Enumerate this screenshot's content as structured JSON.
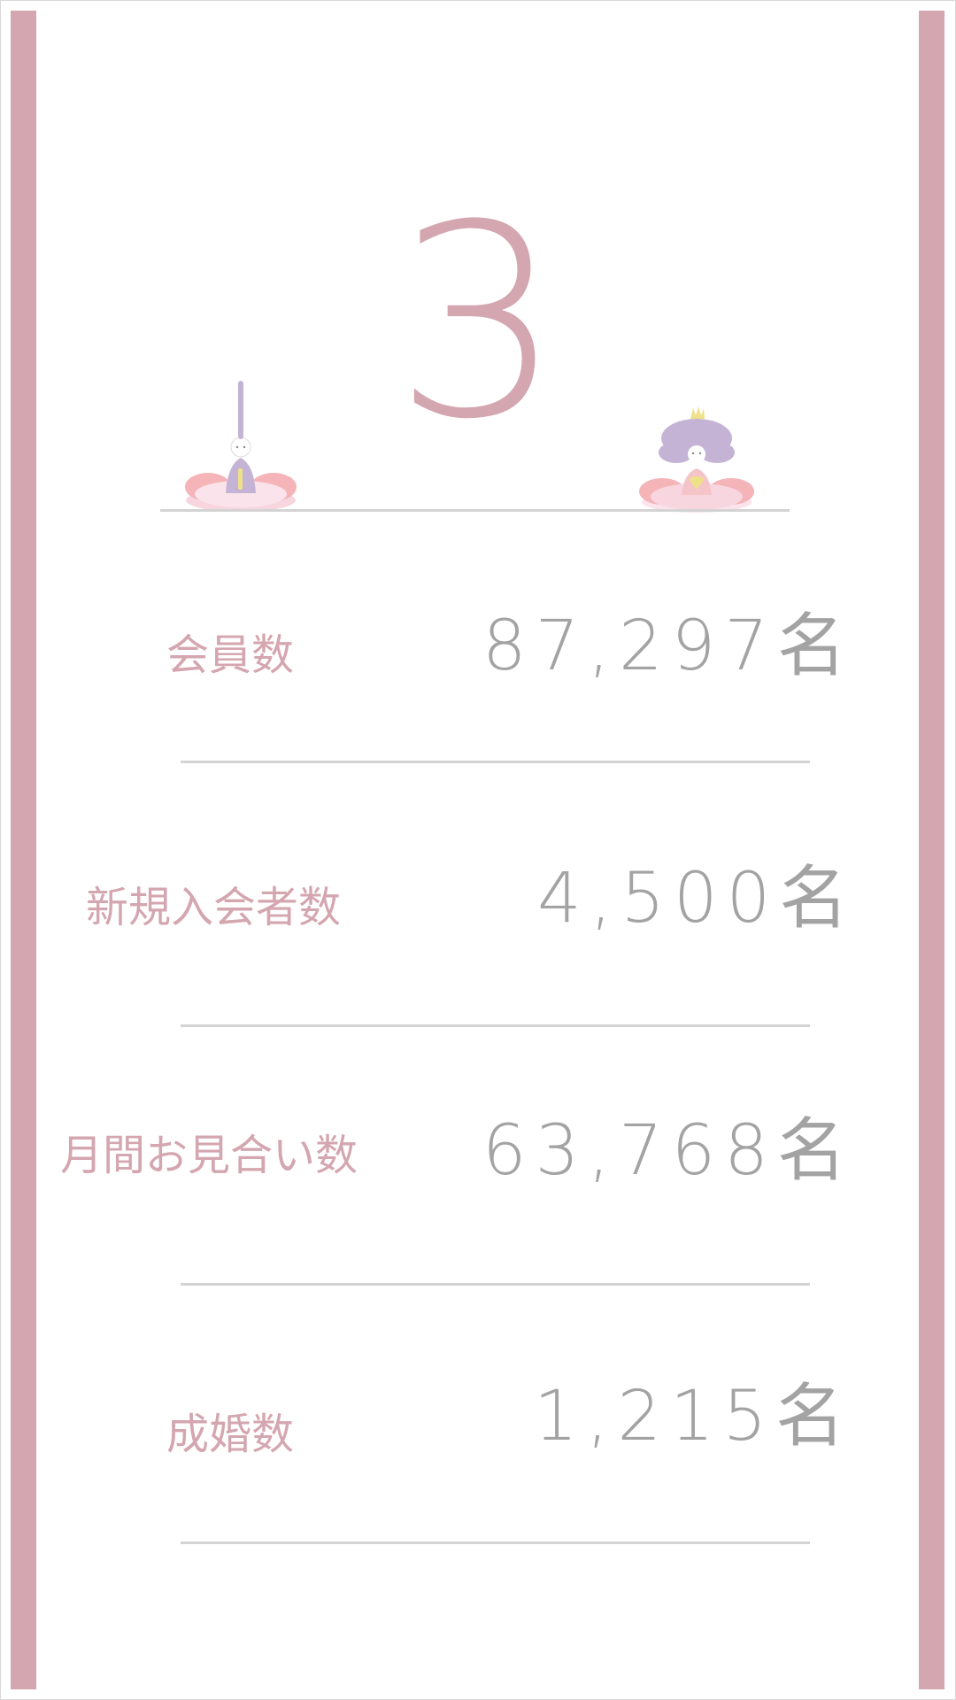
{
  "header": {
    "month_number": "3"
  },
  "decorations": {
    "left_doll": "hina-doll-emperor-icon",
    "right_doll": "hina-doll-empress-icon"
  },
  "stats": [
    {
      "label": "会員数",
      "value": "87,297名"
    },
    {
      "label": "新規入会者数",
      "value": "4,500名"
    },
    {
      "label": "月間お見合い数",
      "value": "63,768名"
    },
    {
      "label": "成婚数",
      "value": "1,215名"
    }
  ],
  "colors": {
    "accent_pink": "#d4a6af",
    "value_gray": "#a3a3a3",
    "divider_gray": "#d3d3d3"
  }
}
